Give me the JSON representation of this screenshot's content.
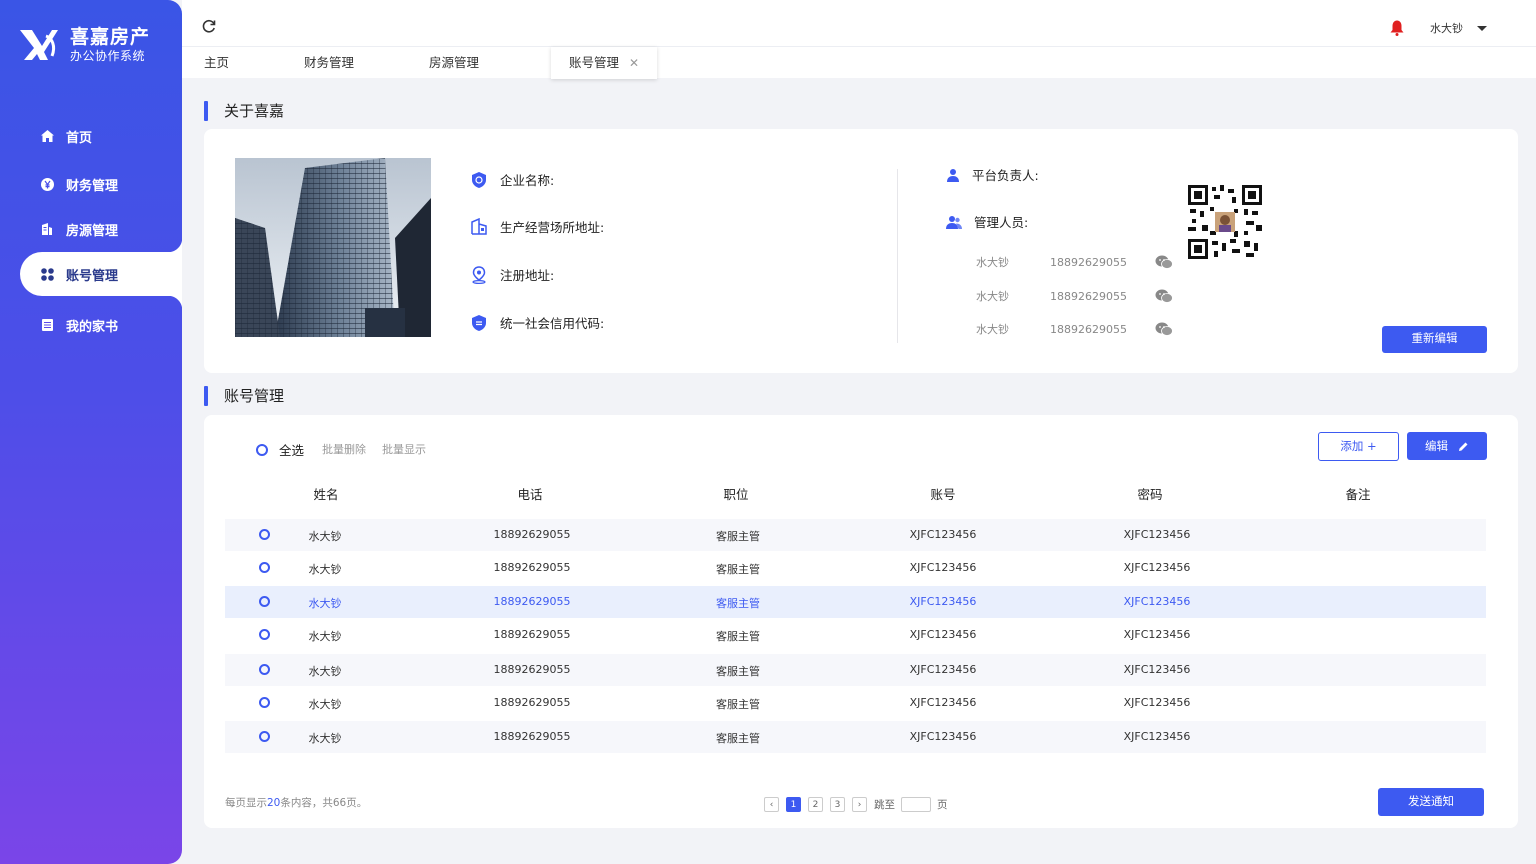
{
  "brand": {
    "title": "喜嘉房产",
    "subtitle": "办公协作系统"
  },
  "sidebar": {
    "items": [
      {
        "label": "首页",
        "icon": "home-icon"
      },
      {
        "label": "财务管理",
        "icon": "yen-icon"
      },
      {
        "label": "房源管理",
        "icon": "building-icon"
      },
      {
        "label": "账号管理",
        "icon": "grid-icon",
        "active": true
      },
      {
        "label": "我的家书",
        "icon": "document-icon"
      }
    ]
  },
  "header": {
    "user": "水大钞"
  },
  "tabs": [
    {
      "label": "主页"
    },
    {
      "label": "财务管理"
    },
    {
      "label": "房源管理"
    },
    {
      "label": "账号管理",
      "active": true,
      "close": "✕"
    }
  ],
  "about": {
    "title": "关于喜嘉",
    "fields": {
      "company_name": "企业名称:",
      "business_address": "生产经营场所地址:",
      "registered_address": "注册地址:",
      "credit_code": "统一社会信用代码:"
    },
    "platform_owner": "平台负责人:",
    "managers_label": "管理人员:",
    "managers": [
      {
        "name": "水大钞",
        "phone": "18892629055"
      },
      {
        "name": "水大钞",
        "phone": "18892629055"
      },
      {
        "name": "水大钞",
        "phone": "18892629055"
      }
    ],
    "reedit": "重新编辑"
  },
  "accounts": {
    "title": "账号管理",
    "select_all": "全选",
    "batch_delete": "批量删除",
    "batch_show": "批量显示",
    "add": "添加 +",
    "edit": "编辑",
    "columns": [
      "姓名",
      "电话",
      "职位",
      "账号",
      "密码",
      "备注"
    ],
    "rows": [
      {
        "name": "水大钞",
        "phone": "18892629055",
        "position": "客服主管",
        "account": "XJFC123456",
        "password": "XJFC123456",
        "note": ""
      },
      {
        "name": "水大钞",
        "phone": "18892629055",
        "position": "客服主管",
        "account": "XJFC123456",
        "password": "XJFC123456",
        "note": ""
      },
      {
        "name": "水大钞",
        "phone": "18892629055",
        "position": "客服主管",
        "account": "XJFC123456",
        "password": "XJFC123456",
        "note": ""
      },
      {
        "name": "水大钞",
        "phone": "18892629055",
        "position": "客服主管",
        "account": "XJFC123456",
        "password": "XJFC123456",
        "note": ""
      },
      {
        "name": "水大钞",
        "phone": "18892629055",
        "position": "客服主管",
        "account": "XJFC123456",
        "password": "XJFC123456",
        "note": ""
      },
      {
        "name": "水大钞",
        "phone": "18892629055",
        "position": "客服主管",
        "account": "XJFC123456",
        "password": "XJFC123456",
        "note": ""
      },
      {
        "name": "水大钞",
        "phone": "18892629055",
        "position": "客服主管",
        "account": "XJFC123456",
        "password": "XJFC123456",
        "note": ""
      }
    ],
    "highlighted_row": 3,
    "pagination": {
      "info_prefix": "每页显示",
      "per_page": "20",
      "info_suffix": "条内容，共66页。",
      "pages": [
        "1",
        "2",
        "3"
      ],
      "current": "1",
      "prev": "‹",
      "next": "›",
      "jump_label": "跳至",
      "page_unit": "页"
    },
    "send_notice": "发送通知"
  },
  "colors": {
    "accent": "#3d5af1",
    "sidebar_top": "#3a55e6",
    "sidebar_bottom": "#7a45e8",
    "bell": "#e02020"
  }
}
